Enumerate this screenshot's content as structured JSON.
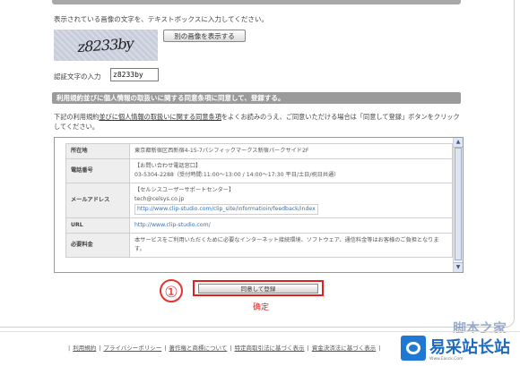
{
  "captcha": {
    "instruction": "表示されている画像の文字を、テキストボックスに入力してください。",
    "image_text": "z8233by",
    "other_image_button": "別の画像を表示する",
    "input_label": "認証文字の入力",
    "input_value": "z8233by"
  },
  "terms": {
    "section_title": "利用規約並びに個人情報の取扱いに関する同意条項に同意して、登録する。",
    "desc_prefix": "下記の利用規約",
    "desc_link": "並びに個人情報の取扱いに関する同意条項",
    "desc_suffix": "をよくお読みのうえ、ご同意いただける場合は「同意して登録」ボタンをクリックしてください。"
  },
  "info_table": {
    "rows": [
      {
        "label": "所在地",
        "lines": [
          "東京都新宿区西新宿4-15-7パシフィックマークス新宿パークサイド2F"
        ]
      },
      {
        "label": "電話番号",
        "lines": [
          "【お問い合わせ電話窓口】",
          "03-5304-2288（受付時間:11:00〜13:00 / 14:00〜17:30 平日/土日/祝日共通）"
        ]
      },
      {
        "label": "メールアドレス",
        "lines": [
          "【セルシスユーザーサポートセンター】",
          "tech@celsys.co.jp"
        ],
        "link": "http://www.clip-studio.com/clip_site/informatioin/feedback/index"
      },
      {
        "label": "URL",
        "link": "http://www.clip-studio.com/"
      },
      {
        "label": "必要料金",
        "lines": [
          "本サービスをご利用いただくために必要なインターネット接続環境、ソフトウェア、通信料金等はお客様のご負担となります。"
        ]
      }
    ]
  },
  "annotation": {
    "step_number": "①",
    "confirm_label": "确定"
  },
  "agree_button": "同意して登録",
  "footer": {
    "links": [
      "利用規約",
      "プライバシーポリシー",
      "著作権と商標について",
      "特定商取引法に基づく表示",
      "資金決済法に基づく表示"
    ]
  },
  "watermark": {
    "brand_partial": "脚本之家",
    "logo_text": "易采站长站",
    "logo_sub": "Www.Easck.Com"
  }
}
